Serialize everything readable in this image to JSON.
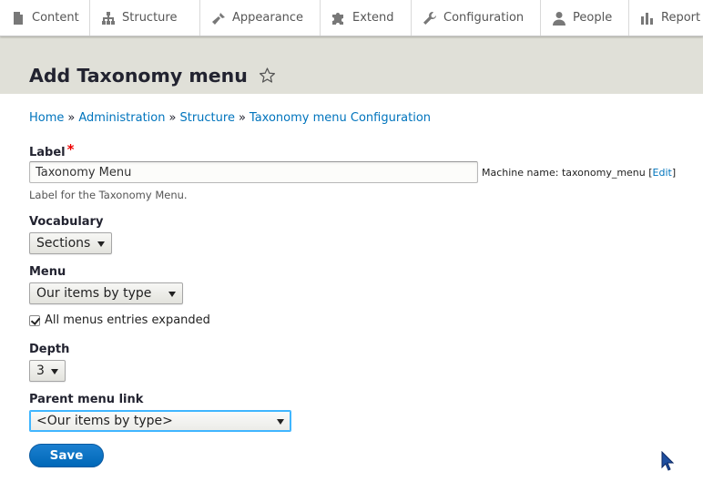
{
  "toolbar": {
    "items": [
      {
        "label": "Content",
        "icon": "file-icon"
      },
      {
        "label": "Structure",
        "icon": "sitemap-icon"
      },
      {
        "label": "Appearance",
        "icon": "brush-icon"
      },
      {
        "label": "Extend",
        "icon": "puzzle-icon"
      },
      {
        "label": "Configuration",
        "icon": "wrench-icon"
      },
      {
        "label": "People",
        "icon": "person-icon"
      },
      {
        "label": "Report",
        "icon": "bar-chart-icon"
      }
    ]
  },
  "page": {
    "title": "Add Taxonomy menu"
  },
  "breadcrumb": {
    "items": [
      "Home",
      "Administration",
      "Structure",
      "Taxonomy menu Configuration"
    ],
    "separator": "»"
  },
  "form": {
    "label_field": {
      "label": "Label",
      "required_mark": "*",
      "value": "Taxonomy Menu",
      "machine_name_prefix": "Machine name: taxonomy_menu [",
      "machine_name_edit": "Edit",
      "machine_name_suffix": "]",
      "description": "Label for the Taxonomy Menu."
    },
    "vocabulary": {
      "label": "Vocabulary",
      "selected": "Sections"
    },
    "menu": {
      "label": "Menu",
      "selected": "Our items by type"
    },
    "expanded": {
      "label": "All menus entries expanded",
      "checked": true
    },
    "depth": {
      "label": "Depth",
      "selected": "3"
    },
    "parent_menu_link": {
      "label": "Parent menu link",
      "selected": "<Our items by type>"
    },
    "save_label": "Save"
  },
  "colors": {
    "header_bg": "#e0e0d8",
    "link": "#0074bd",
    "primary_button": "#0071c2",
    "required": "#ee0000",
    "focus": "#40b6ff"
  }
}
